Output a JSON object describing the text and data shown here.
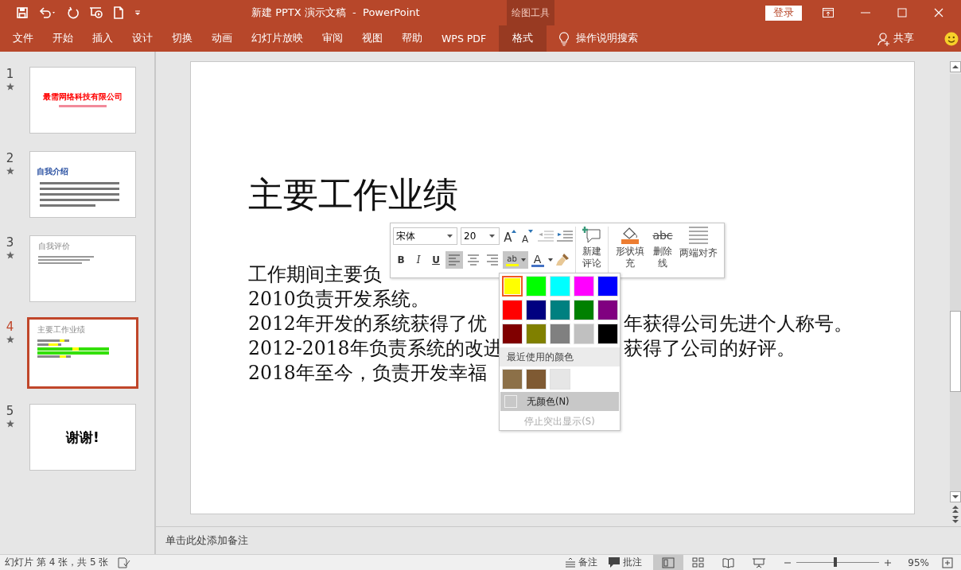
{
  "window": {
    "title": "新建 PPTX 演示文稿  -  PowerPoint",
    "context_group": "绘图工具",
    "sign_in": "登录"
  },
  "ribbon_tabs": [
    {
      "label": "文件",
      "selected": false
    },
    {
      "label": "开始",
      "selected": false
    },
    {
      "label": "插入",
      "selected": false
    },
    {
      "label": "设计",
      "selected": false
    },
    {
      "label": "切换",
      "selected": false
    },
    {
      "label": "动画",
      "selected": false
    },
    {
      "label": "幻灯片放映",
      "selected": false
    },
    {
      "label": "审阅",
      "selected": false
    },
    {
      "label": "视图",
      "selected": false
    },
    {
      "label": "帮助",
      "selected": false
    },
    {
      "label": "WPS PDF",
      "selected": false
    },
    {
      "label": "格式",
      "selected": true
    }
  ],
  "tell_me": "操作说明搜索",
  "share": "共享",
  "thumbnails": [
    {
      "number": "1",
      "selected": false,
      "kind": "title",
      "title": "最需网络科技有限公司"
    },
    {
      "number": "2",
      "selected": false,
      "kind": "text",
      "title": "自我介绍"
    },
    {
      "number": "3",
      "selected": false,
      "kind": "notes",
      "title": "自我评价"
    },
    {
      "number": "4",
      "selected": true,
      "kind": "highlight",
      "title": "主要工作业绩"
    },
    {
      "number": "5",
      "selected": false,
      "kind": "thanks",
      "title": "谢谢!"
    }
  ],
  "slide": {
    "title": "主要工作业绩",
    "lines": [
      {
        "left": "工作期间主要负"
      },
      {
        "left": "2010负责开发系统。"
      },
      {
        "left": "2012年开发的系统获得了优",
        "right": "年获得公司先进个人称号。"
      },
      {
        "left": "2012-2018年负责系统的改进",
        "right": "获得了公司的好评。"
      },
      {
        "left": "2018年至今，负责开发幸福"
      }
    ]
  },
  "mini_toolbar": {
    "font": "宋体",
    "size": "20",
    "size_buttons": [
      {
        "kind": "grow",
        "label": "A"
      },
      {
        "kind": "shrink",
        "label": "A"
      }
    ],
    "style_buttons": [
      {
        "kind": "bold",
        "label": "B"
      },
      {
        "kind": "italic",
        "label": "I"
      },
      {
        "kind": "underline",
        "label": "U"
      }
    ],
    "align_buttons": [
      {
        "kind": "left",
        "selected": true
      },
      {
        "kind": "center",
        "selected": false
      },
      {
        "kind": "right",
        "selected": false
      }
    ],
    "highlight_glyph": "ab",
    "font_color_glyph": "A",
    "new_comment": "新建评论",
    "shape_fill": "形状填充",
    "strike_glyph": "abc",
    "strikethrough": "删除线",
    "justify": "两端对齐"
  },
  "highlight_menu": {
    "colors": [
      {
        "color": "#ffff00",
        "selected": true
      },
      {
        "color": "#00ff00",
        "selected": false
      },
      {
        "color": "#00ffff",
        "selected": false
      },
      {
        "color": "#ff00ff",
        "selected": false
      },
      {
        "color": "#0000ff",
        "selected": false
      },
      {
        "color": "#ff0000",
        "selected": false
      },
      {
        "color": "#000080",
        "selected": false
      },
      {
        "color": "#008080",
        "selected": false
      },
      {
        "color": "#008000",
        "selected": false
      },
      {
        "color": "#800080",
        "selected": false
      },
      {
        "color": "#800000",
        "selected": false
      },
      {
        "color": "#808000",
        "selected": false
      },
      {
        "color": "#808080",
        "selected": false
      },
      {
        "color": "#c0c0c0",
        "selected": false
      },
      {
        "color": "#000000",
        "selected": false
      }
    ],
    "recent_heading": "最近使用的颜色",
    "recent_colors": [
      {
        "color": "#8c7048"
      },
      {
        "color": "#7f5a33"
      },
      {
        "color": "#e6e6e6"
      }
    ],
    "no_color": "无颜色(N)",
    "stop": "停止突出显示(S)",
    "stop_disabled": true
  },
  "notes_placeholder": "单击此处添加备注",
  "status_bar": {
    "slide_info": "幻灯片 第 4 张，共 5 张",
    "notes": "备注",
    "comments": "批注",
    "views": [
      {
        "kind": "normal",
        "selected": true
      },
      {
        "kind": "sorter",
        "selected": false
      },
      {
        "kind": "reading",
        "selected": false
      },
      {
        "kind": "show",
        "selected": false
      }
    ],
    "zoom_slider": {
      "level": 0.45
    },
    "zoom": "95%"
  }
}
